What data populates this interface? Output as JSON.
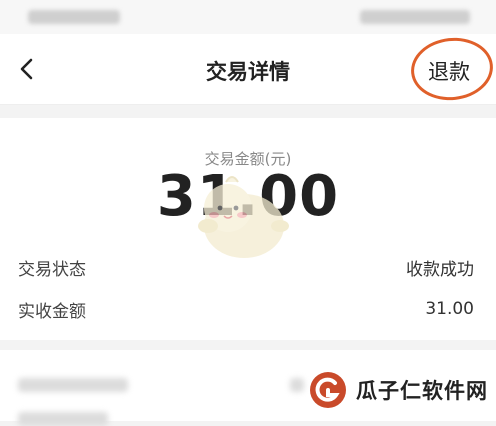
{
  "nav": {
    "title": "交易详情",
    "back_icon": "chevron-left-icon",
    "refund_label": "退款"
  },
  "amount": {
    "label": "交易金额(元)",
    "value": "31.00"
  },
  "details": [
    {
      "label": "交易状态",
      "value": "收款成功"
    },
    {
      "label": "实收金额",
      "value": "31.00"
    }
  ],
  "watermark": {
    "text": "瓜子仁软件网"
  },
  "colors": {
    "highlight": "#e0602a",
    "watermark_logo": "#c94a2a"
  }
}
